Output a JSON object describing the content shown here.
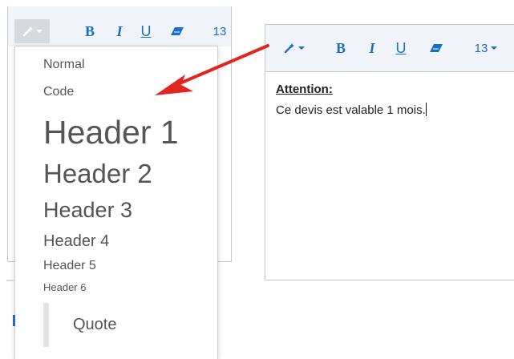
{
  "left_toolbar": {
    "bold": "B",
    "italic": "I",
    "underline": "U",
    "font_size": "13"
  },
  "dropdown": {
    "items": [
      "Normal",
      "Code",
      "Header 1",
      "Header 2",
      "Header 3",
      "Header 4",
      "Header 5",
      "Header 6",
      "Quote"
    ]
  },
  "right_toolbar": {
    "bold": "B",
    "italic": "I",
    "underline": "U",
    "font_size": "13"
  },
  "editor": {
    "heading": "Attention:",
    "body": "Ce devis est valable 1 mois."
  },
  "colors": {
    "accent": "#1a6fc7",
    "arrow": "#e0261e"
  }
}
